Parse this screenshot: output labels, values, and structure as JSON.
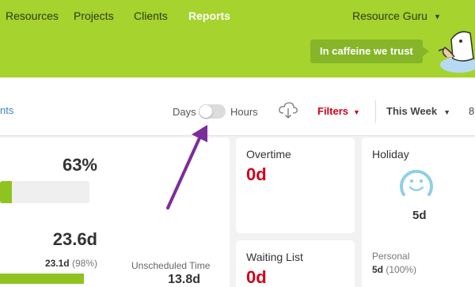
{
  "nav": {
    "items": [
      {
        "label": "Resources",
        "active": false
      },
      {
        "label": "Projects",
        "active": false
      },
      {
        "label": "Clients",
        "active": false
      },
      {
        "label": "Reports",
        "active": true
      }
    ],
    "account": "Resource Guru",
    "tooltip": "In caffeine we trust"
  },
  "toolbar": {
    "partial_link": "nts",
    "days_label": "Days",
    "hours_label": "Hours",
    "toggle_state": "days",
    "filters_label": "Filters",
    "range_label": "This Week",
    "extra_label": "8"
  },
  "utilization": {
    "percent": "63%",
    "bar_fill_fraction": 0.13,
    "total": "23.6d",
    "scheduled": "23.1d",
    "scheduled_percent": "(98%)",
    "unscheduled_label": "Unscheduled Time",
    "unscheduled_value": "13.8d"
  },
  "overtime": {
    "title": "Overtime",
    "value": "0d"
  },
  "waiting_list": {
    "title": "Waiting List",
    "value": "0d"
  },
  "holiday": {
    "title": "Holiday",
    "value": "5d",
    "personal_label": "Personal",
    "personal_value": "5d",
    "personal_percent": "(100%)"
  },
  "colors": {
    "brand_green": "#a6d32e",
    "accent_red": "#d0021b",
    "link_blue": "#3a84c5",
    "annotation_arrow": "#7b2d9a"
  },
  "icons": [
    "chevron-down-icon",
    "cloud-download-icon",
    "smiley-icon",
    "mascot-illustration",
    "annotation-arrow"
  ]
}
